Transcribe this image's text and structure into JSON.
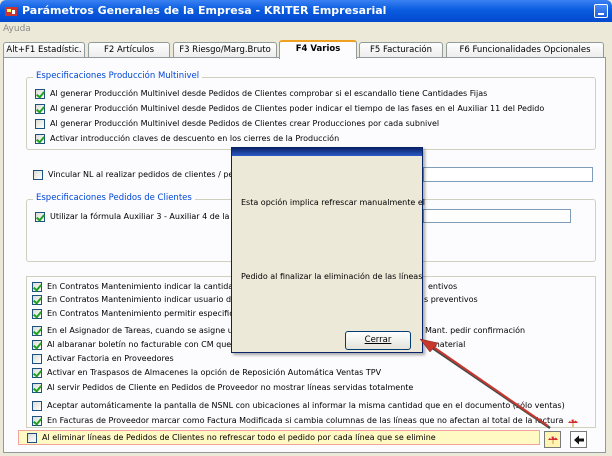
{
  "window": {
    "title": "Parámetros Generales de la Empresa - KRITER Empresarial"
  },
  "menu": {
    "ayuda": "Ayuda"
  },
  "tabs": [
    "Alt+F1 Estadístic.",
    "F2 Artículos",
    "F3 Riesgo/Marg.Bruto",
    "F4 Varios",
    "F5 Facturación",
    "F6 Funcionalidades Opcionales"
  ],
  "active_tab": "F4 Varios",
  "group1": {
    "legend": "Especificaciones Producción Multinivel",
    "items": [
      {
        "label": "Al generar Producción Multinivel desde Pedidos de Clientes comprobar si el escandallo tiene Cantidades Fijas",
        "checked": true
      },
      {
        "label": "Al generar Producción Multinivel desde Pedidos de Clientes poder indicar el tiempo de las fases en el Auxiliar 11 del Pedido",
        "checked": true
      },
      {
        "label": "Al generar Producción Multinivel desde Pedidos de Clientes crear Producciones por cada subnivel",
        "checked": false
      },
      {
        "label": "Activar introducción claves de descuento en los cierres de la Producción",
        "checked": true
      }
    ]
  },
  "vincular": {
    "label": "Vincular NL al realizar  pedidos de clientes /  ped",
    "checked": false
  },
  "group2": {
    "legend": "Especificaciones Pedidos de Clientes",
    "items": [
      {
        "label": "Utilizar la fórmula Auxiliar 3 - Auxiliar 4 de la línea",
        "checked": true
      }
    ]
  },
  "list": [
    {
      "label": "En Contratos Mantenimiento indicar la cantidad de",
      "right": "entivos",
      "checked": true
    },
    {
      "label": "En Contratos Mantenimiento indicar usuario diferen",
      "right": "s preventivos",
      "checked": true
    },
    {
      "label": "En Contratos Mantenimiento permitir especificar la",
      "right": "",
      "checked": true
    },
    {
      "label": "En el Asignador de Tareas, cuando se asigne una",
      "right": "Mant. pedir confirmación",
      "checked": true
    },
    {
      "label": "Al albaranar boletín no facturable con CM que no",
      "right": "material",
      "checked": true
    },
    {
      "label": "Activar Factoria en Proveedores",
      "right": "",
      "checked": false
    },
    {
      "label": "Activar en Traspasos de Almacenes la opción de Reposición Automática Ventas TPV",
      "right": "",
      "checked": true
    },
    {
      "label": "Al servir Pedidos de Cliente en Pedidos de Proveedor no mostrar líneas servidas totalmente",
      "right": "",
      "checked": true
    },
    {
      "label": "Aceptar automáticamente la pantalla de NSNL con ubicaciones al informar la misma cantidad que en el documento (sólo ventas)",
      "right": "",
      "checked": false
    },
    {
      "label": "En Facturas de Proveedor marcar como Factura Modificada si cambia columnas de las líneas que no afectan al total de la factura",
      "right": "",
      "checked": true
    }
  ],
  "highlight": {
    "label": "Al eliminar líneas de Pedidos de Clientes no refrescar todo el pedido por cada línea que se elimine",
    "checked": false
  },
  "dialog": {
    "line1": "Esta opción implica refrescar manualmente el",
    "line2": "Pedido al finalizar la eliminación de las líneas",
    "button": "Cerrar"
  },
  "icons": {
    "help": "help-mushroom-icon",
    "back": "back-arrow-icon"
  }
}
